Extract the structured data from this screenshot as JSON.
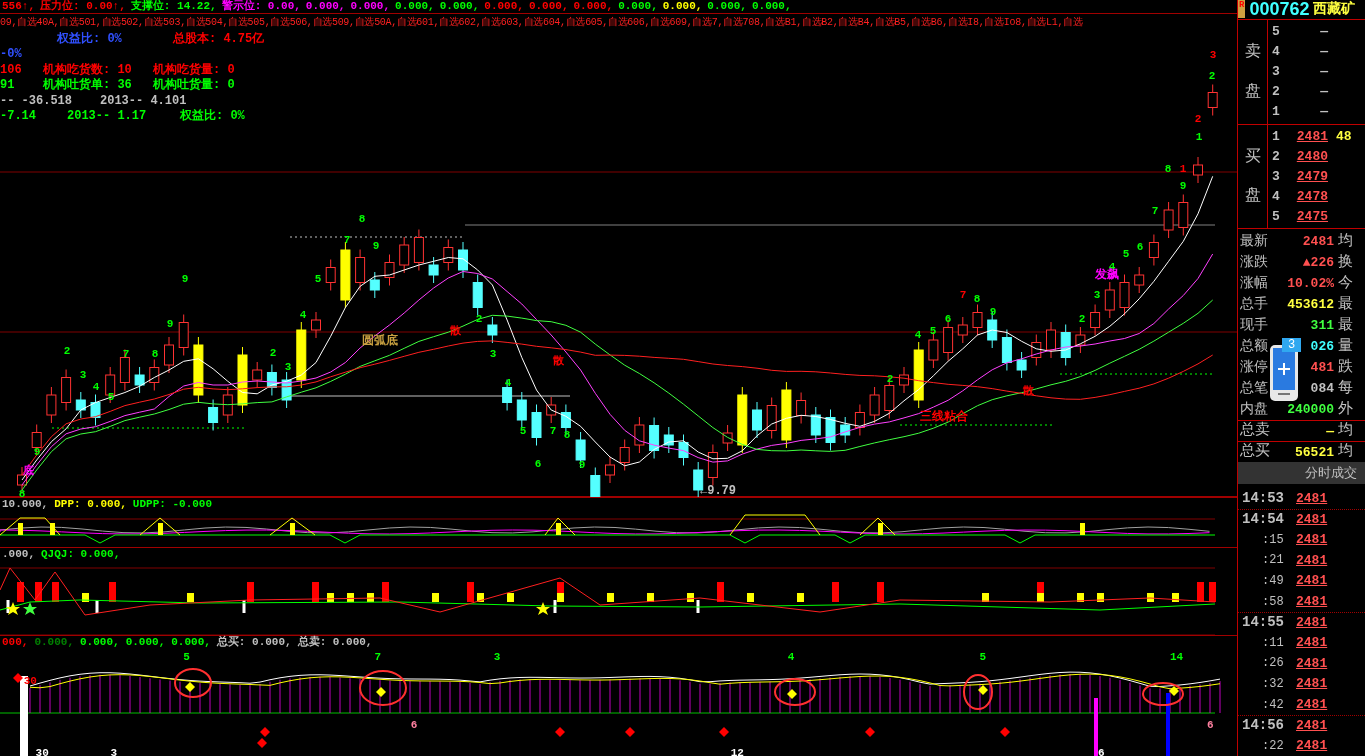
{
  "header_line": [
    {
      "text": "556↑,",
      "color": "#ff0000"
    },
    {
      "text": "压力位: 0.00↑,",
      "color": "#ff0000"
    },
    {
      "text": "支撑位: 14.22,",
      "color": "#00ff00"
    },
    {
      "text": "警示位: 0.00,",
      "color": "#ff00ff"
    },
    {
      "text": "0.000,",
      "color": "#ff00ff"
    },
    {
      "text": "0.000,",
      "color": "#ff00ff"
    },
    {
      "text": "0.000,",
      "color": "#00ff00"
    },
    {
      "text": "0.000,",
      "color": "#00ff00"
    },
    {
      "text": "0.000,",
      "color": "#ff0000"
    },
    {
      "text": "0.000,",
      "color": "#ff0000"
    },
    {
      "text": "0.000,",
      "color": "#ff0000"
    },
    {
      "text": "0.000,",
      "color": "#00ff00"
    },
    {
      "text": "0.000,",
      "color": "#ffff00"
    },
    {
      "text": "0.000,",
      "color": "#00ff00"
    },
    {
      "text": "0.000,",
      "color": "#00ff00"
    }
  ],
  "watchlist": "09,自选40A,自选501,自选502,自选503,自选504,自选505,自选506,自选509,自选50A,自选601,自选602,自选603,自选604,自选605,自选606,自选609,自选7,自选708,自选B1,自选B2,自选B4,自选B5,自选B6,自选I8,自选Io8,自选L1,自选",
  "info_rows": [
    [
      {
        "text": "权益比: 0%",
        "color": "#3050ff"
      },
      {
        "text": "总股本: 4.75亿",
        "color": "#ff0000"
      }
    ],
    [
      {
        "text": "-0%",
        "color": "#3050ff"
      }
    ],
    [
      {
        "text": "106",
        "color": "#ff0000"
      },
      {
        "text": "机构吃货数: 10",
        "color": "#ff0000"
      },
      {
        "text": "机构吃货量: 0",
        "color": "#ff0000"
      }
    ],
    [
      {
        "text": "91",
        "color": "#00ff00"
      },
      {
        "text": "机构吐货单: 36",
        "color": "#00ff00"
      },
      {
        "text": "机构吐货量: 0",
        "color": "#00ff00"
      }
    ],
    [
      {
        "text": "-- -36.518",
        "color": "#c0c0c0"
      },
      {
        "text": "2013-- 4.101",
        "color": "#c0c0c0"
      }
    ],
    [
      {
        "text": "-7.14",
        "color": "#00ff00"
      },
      {
        "text": "2013-- 1.17",
        "color": "#00ff00"
      },
      {
        "text": "权益比: 0%",
        "color": "#00ff00"
      }
    ]
  ],
  "main_chart": {
    "labels": [
      {
        "text": "8",
        "color": "#00ff00"
      },
      {
        "text": "9",
        "color": "#00ff00"
      },
      {
        "text": "2",
        "color": "#00ff00"
      },
      {
        "text": "3",
        "color": "#00ff00"
      },
      {
        "text": "4",
        "color": "#00ff00"
      },
      {
        "text": "5",
        "color": "#00ff00"
      },
      {
        "text": "7",
        "color": "#00ff00"
      },
      {
        "text": "8",
        "color": "#00ff00"
      },
      {
        "text": "9",
        "color": "#00ff00"
      },
      {
        "text": "9",
        "color": "#00ff00"
      },
      {
        "text": "2",
        "color": "#00ff00"
      },
      {
        "text": "3",
        "color": "#00ff00"
      },
      {
        "text": "4",
        "color": "#00ff00"
      },
      {
        "text": "5",
        "color": "#00ff00"
      },
      {
        "text": "7",
        "color": "#00ff00"
      },
      {
        "text": "8",
        "color": "#00ff00"
      },
      {
        "text": "9",
        "color": "#00ff00"
      },
      {
        "text": "2",
        "color": "#00ff00"
      },
      {
        "text": "3",
        "color": "#00ff00"
      },
      {
        "text": "4",
        "color": "#00ff00"
      },
      {
        "text": "5",
        "color": "#00ff00"
      },
      {
        "text": "6",
        "color": "#00ff00"
      },
      {
        "text": "7",
        "color": "#00ff00"
      },
      {
        "text": "8",
        "color": "#00ff00"
      },
      {
        "text": "9",
        "color": "#00ff00"
      },
      {
        "text": "2",
        "color": "#00ff00"
      },
      {
        "text": "4",
        "color": "#00ff00"
      },
      {
        "text": "5",
        "color": "#00ff00"
      },
      {
        "text": "6",
        "color": "#00ff00"
      },
      {
        "text": "7",
        "color": "#ff0000"
      },
      {
        "text": "8",
        "color": "#00ff00"
      },
      {
        "text": "9",
        "color": "#00ff00"
      },
      {
        "text": "2",
        "color": "#00ff00"
      },
      {
        "text": "3",
        "color": "#00ff00"
      },
      {
        "text": "4",
        "color": "#00ff00"
      },
      {
        "text": "5",
        "color": "#00ff00"
      },
      {
        "text": "6",
        "color": "#00ff00"
      },
      {
        "text": "7",
        "color": "#00ff00"
      },
      {
        "text": "8",
        "color": "#00ff00"
      },
      {
        "text": "9",
        "color": "#00ff00"
      },
      {
        "text": "1",
        "color": "#ff0000"
      },
      {
        "text": "2",
        "color": "#ff0000"
      },
      {
        "text": "1",
        "color": "#00ff00"
      },
      {
        "text": "2",
        "color": "#00ff00"
      },
      {
        "text": "3",
        "color": "#ff0000"
      },
      {
        "text": "底",
        "color": "#ff00ff"
      },
      {
        "text": "圆弧底",
        "color": "#c8a040"
      },
      {
        "text": "散",
        "color": "#ff0000"
      },
      {
        "text": "散",
        "color": "#ff0000"
      },
      {
        "text": "三线粘合",
        "color": "#ff0000"
      },
      {
        "text": "散",
        "color": "#ff0000"
      },
      {
        "text": "发飙",
        "color": "#ff00ff"
      },
      {
        "text": "←9.79",
        "color": "#c0c0c0"
      }
    ]
  },
  "panel_2_title": [
    {
      "text": "10.000,",
      "color": "#c0c0c0"
    },
    {
      "text": "DPP: 0.000,",
      "color": "#ffff00"
    },
    {
      "text": "UDPP: -0.000",
      "color": "#00ff00"
    }
  ],
  "panel_3_title": [
    {
      "text": ".000,",
      "color": "#c0c0c0"
    },
    {
      "text": "QJQJ: 0.000,",
      "color": "#00ff00"
    }
  ],
  "panel_4_title": [
    {
      "text": "000,",
      "color": "#ff0000"
    },
    {
      "text": "0.000,",
      "color": "#008000"
    },
    {
      "text": "0.000,",
      "color": "#00ff00"
    },
    {
      "text": "0.000,",
      "color": "#00ff00"
    },
    {
      "text": "0.000,",
      "color": "#00ff00"
    },
    {
      "text": "总买: 0.000,",
      "color": "#c0c0c0"
    },
    {
      "text": "总卖: 0.000,",
      "color": "#c0c0c0"
    }
  ],
  "panel_4_labels": [
    {
      "text": "5",
      "color": "#00ff00"
    },
    {
      "text": "7",
      "color": "#00ff00"
    },
    {
      "text": "3",
      "color": "#00ff00"
    },
    {
      "text": "4",
      "color": "#00ff00"
    },
    {
      "text": "5",
      "color": "#00ff00"
    },
    {
      "text": "14",
      "color": "#00ff00"
    },
    {
      "text": "30",
      "color": "#ff0000"
    },
    {
      "text": "30",
      "color": "#ffffff"
    },
    {
      "text": "3",
      "color": "#ffffff"
    },
    {
      "text": "12",
      "color": "#ffffff"
    },
    {
      "text": "6",
      "color": "#ffffff"
    },
    {
      "text": "6",
      "color": "#ff80a0"
    },
    {
      "text": "6",
      "color": "#ff80a0"
    }
  ],
  "quote": {
    "badge": "R",
    "code": "000762",
    "name": "西藏矿",
    "sell_side": [
      "卖",
      "盘"
    ],
    "sell": [
      {
        "rank": "5",
        "price": "—"
      },
      {
        "rank": "4",
        "price": "—"
      },
      {
        "rank": "3",
        "price": "—"
      },
      {
        "rank": "2",
        "price": "—"
      },
      {
        "rank": "1",
        "price": "—"
      }
    ],
    "buy_side": [
      "买",
      "盘"
    ],
    "buy": [
      {
        "rank": "1",
        "price": "2481",
        "volume": "48"
      },
      {
        "rank": "2",
        "price": "2480"
      },
      {
        "rank": "3",
        "price": "2479"
      },
      {
        "rank": "4",
        "price": "2478"
      },
      {
        "rank": "5",
        "price": "2475"
      }
    ],
    "stats": [
      {
        "label": "最新",
        "value": "2481",
        "color": "#ff5050",
        "right": "均"
      },
      {
        "label": "涨跌",
        "value": "▲226",
        "color": "#ff5050",
        "right": "换"
      },
      {
        "label": "涨幅",
        "value": "10.02%",
        "color": "#ff5050",
        "right": "今"
      },
      {
        "label": "总手",
        "value": "453612",
        "color": "#ffff40",
        "right": "最"
      },
      {
        "label": "现手",
        "value": "311",
        "color": "#40ff40",
        "right": "最"
      },
      {
        "label": "总额",
        "value": "026",
        "color": "#40ffff",
        "right": "量"
      },
      {
        "label": "涨停",
        "value": "481",
        "color": "#ff5050",
        "right": "跌"
      },
      {
        "label": "总笔",
        "value": "084",
        "color": "#c0c0c0",
        "right": "每"
      },
      {
        "label": "内盘",
        "value": "240000",
        "color": "#40ff40",
        "right": "外"
      }
    ],
    "totals": [
      {
        "label": "总卖",
        "value": "—",
        "right": "均"
      },
      {
        "label": "总买",
        "value": "56521",
        "right": "均"
      }
    ],
    "phone_badge": "3",
    "trades_title": "分时成交",
    "trades": [
      {
        "time": "14:53",
        "price": "2481",
        "kind": "minute"
      },
      {
        "time": "14:54",
        "price": "2481",
        "kind": "minute"
      },
      {
        "time": ":15",
        "price": "2481",
        "kind": "second"
      },
      {
        "time": ":21",
        "price": "2481",
        "kind": "second"
      },
      {
        "time": ":49",
        "price": "2481",
        "kind": "second"
      },
      {
        "time": ":58",
        "price": "2481",
        "kind": "second"
      },
      {
        "time": "14:55",
        "price": "2481",
        "kind": "minute"
      },
      {
        "time": ":11",
        "price": "2481",
        "kind": "second"
      },
      {
        "time": ":26",
        "price": "2481",
        "kind": "second"
      },
      {
        "time": ":32",
        "price": "2481",
        "kind": "second"
      },
      {
        "time": ":42",
        "price": "2481",
        "kind": "second"
      },
      {
        "time": "14:56",
        "price": "2481",
        "kind": "minute"
      },
      {
        "time": ":22",
        "price": "2481",
        "kind": "second"
      }
    ]
  }
}
